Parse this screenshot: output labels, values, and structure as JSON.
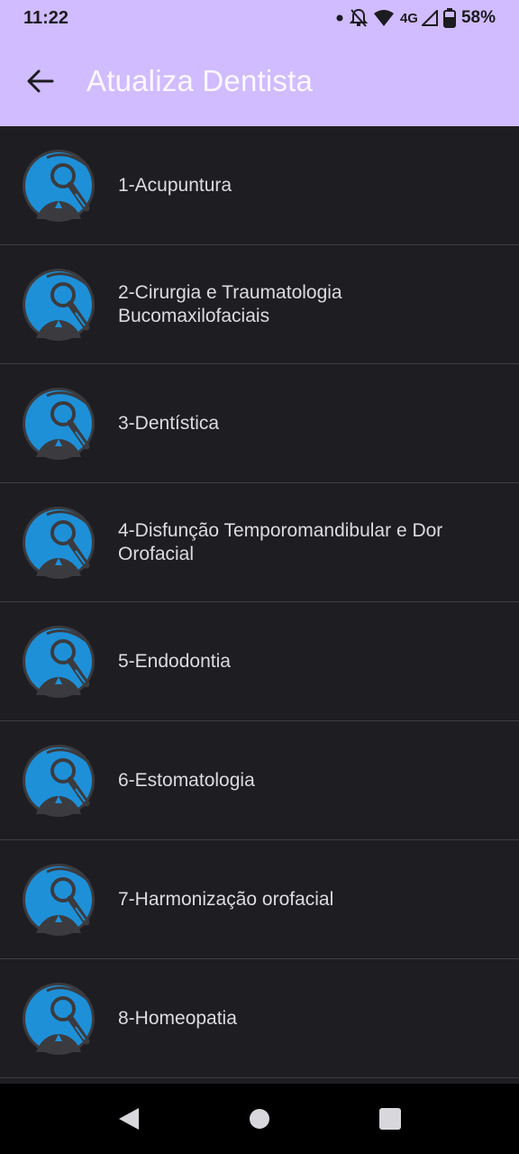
{
  "status_bar": {
    "time": "11:22",
    "network": "4G",
    "battery": "58%"
  },
  "app_bar": {
    "title": "Atualiza Dentista"
  },
  "specialties": [
    "1-Acupuntura",
    "2-Cirurgia e Traumatologia Bucomaxilofaciais",
    "3-Dentística",
    "4-Disfunção Temporomandibular e Dor Orofacial",
    "5-Endodontia",
    "6-Estomatologia",
    "7-Harmonização orofacial",
    "8-Homeopatia"
  ],
  "colors": {
    "app_bar": "#d0bcfe",
    "background": "#1e1e22",
    "avatar_blue": "#1e90d8",
    "avatar_dark": "#3b3b3f"
  },
  "icons": {
    "avatar": "magnifier-tooth-icon",
    "back": "arrow-left-icon",
    "nav_back": "triangle-back-icon",
    "nav_home": "circle-home-icon",
    "nav_recents": "square-recents-icon"
  }
}
